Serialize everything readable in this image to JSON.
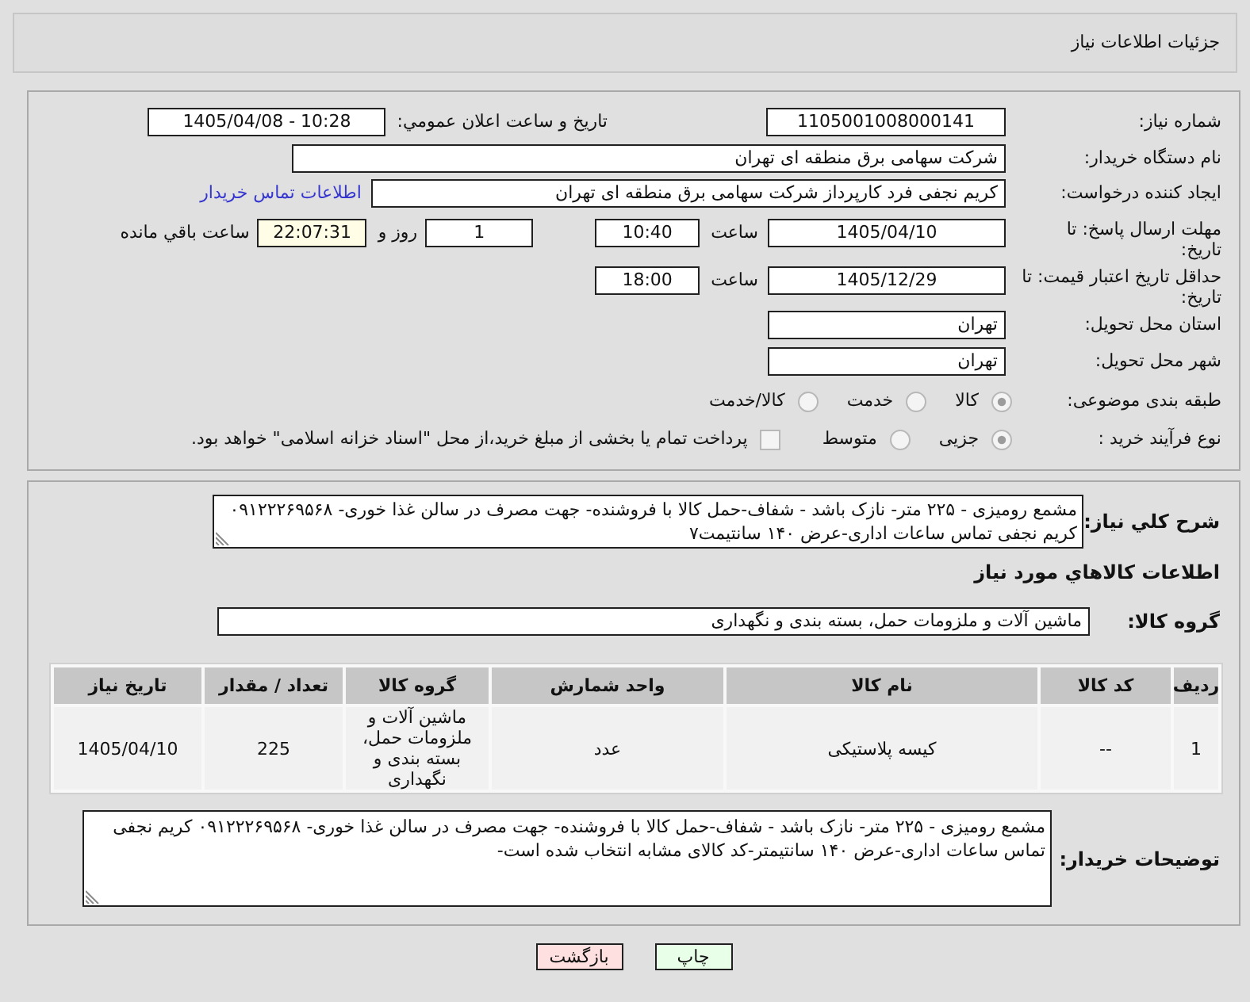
{
  "header": {
    "title": "جزئیات اطلاعات نیاز"
  },
  "details": {
    "need_number": {
      "label": "شماره نیاز:",
      "value": "1105001008000141"
    },
    "announcement": {
      "label": "تاریخ و ساعت اعلان عمومي:",
      "value": "1405/04/08 - 10:28"
    },
    "buyer_org": {
      "label": "نام دستگاه خریدار:",
      "value": "شرکت سهامی برق منطقه ای تهران"
    },
    "requester": {
      "label": "ایجاد کننده درخواست:",
      "value": "کریم نجفی فرد کارپرداز شرکت سهامی برق منطقه ای تهران",
      "contact_link": "اطلاعات تماس خریدار"
    },
    "reply_deadline": {
      "label": "مهلت ارسال پاسخ: تا تاریخ:",
      "date": "1405/04/10",
      "time_label": "ساعت",
      "time": "10:40",
      "days": "1",
      "days_label": "روز و",
      "remaining": "22:07:31",
      "remaining_label": "ساعت باقي مانده"
    },
    "price_validity": {
      "label": "حداقل تاریخ اعتبار قیمت: تا تاریخ:",
      "date": "1405/12/29",
      "time_label": "ساعت",
      "time": "18:00"
    },
    "province": {
      "label": "استان محل تحویل:",
      "value": "تهران"
    },
    "city": {
      "label": "شهر محل تحویل:",
      "value": "تهران"
    },
    "category": {
      "label": "طبقه بندی موضوعی:",
      "options": [
        {
          "label": "کالا",
          "selected": true
        },
        {
          "label": "خدمت",
          "selected": false
        },
        {
          "label": "کالا/خدمت",
          "selected": false
        }
      ]
    },
    "purchase_process": {
      "label": "نوع فرآیند خرید :",
      "options": [
        {
          "label": "جزیی",
          "selected": true
        },
        {
          "label": "متوسط",
          "selected": false
        }
      ],
      "treasury_payment": {
        "label": "پرداخت تمام یا بخشی از مبلغ خرید،از محل \"اسناد خزانه اسلامی\" خواهد بود.",
        "checked": false
      }
    }
  },
  "need": {
    "description_label": "شرح کلي نیاز:",
    "description": "مشمع رومیزی - ۲۲۵ متر- نازک باشد - شفاف-حمل کالا با فروشنده- جهت مصرف در سالن غذا خوری- ۰۹۱۲۲۲۶۹۵۶۸ کریم نجفی تماس ساعات اداری-عرض ۱۴۰ سانتیمت۷",
    "goods_heading": "اطلاعات کالاهاي مورد نیاز",
    "group_label": "گروه کالا:",
    "group": "ماشین آلات و ملزومات حمل، بسته بندی و نگهداری"
  },
  "table": {
    "columns": [
      "ردیف",
      "کد کالا",
      "نام کالا",
      "واحد شمارش",
      "گروه کالا",
      "تعداد / مقدار",
      "تاریخ نیاز"
    ],
    "rows": [
      [
        "1",
        "--",
        "کیسه پلاستیکی",
        "عدد",
        "ماشین آلات و ملزومات حمل، بسته بندی و نگهداری",
        "225",
        "1405/04/10"
      ]
    ]
  },
  "buyer_notes": {
    "label": "توضیحات خریدار:",
    "value": "مشمع رومیزی - ۲۲۵ متر- نازک باشد - شفاف-حمل کالا با فروشنده- جهت مصرف در سالن غذا خوری- ۰۹۱۲۲۲۶۹۵۶۸ کریم نجفی تماس ساعات اداری-عرض ۱۴۰ سانتیمتر-کد کالای مشابه انتخاب شده است-"
  },
  "buttons": [
    {
      "label": "چاپ",
      "kind": "print"
    },
    {
      "label": "بازگشت",
      "kind": "back"
    }
  ]
}
